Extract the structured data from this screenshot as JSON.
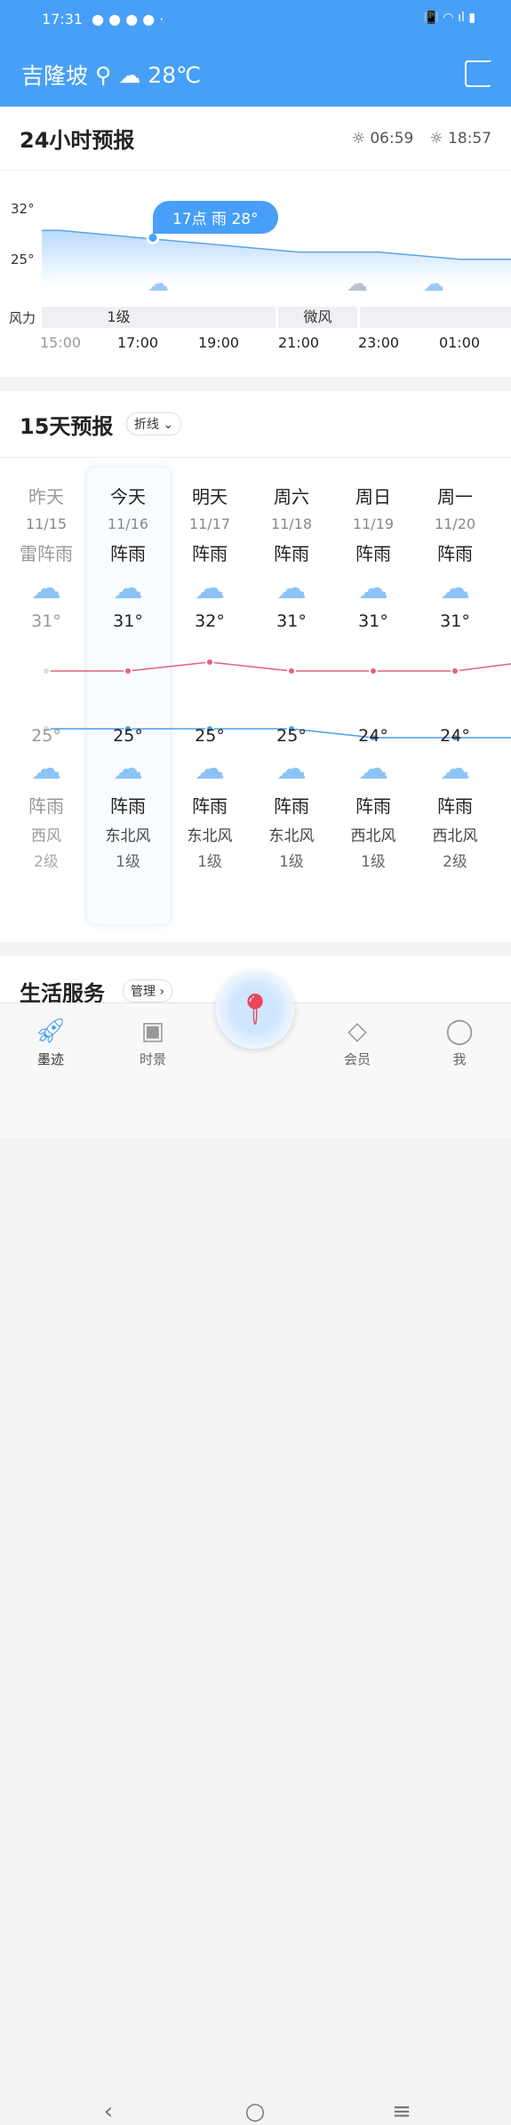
{
  "status": {
    "time": "17:31"
  },
  "header": {
    "city": "吉隆坡",
    "temp": "28℃",
    "weather_icon": "cloud-rain-icon"
  },
  "hourly": {
    "title": "24小时预报",
    "sunrise": "06:59",
    "sunset": "18:57",
    "y_ticks": [
      "32°",
      "25°"
    ],
    "tooltip": "17点 雨 28°",
    "wind_label": "风力",
    "wind": [
      {
        "label": "1级"
      },
      {
        "label": "微风"
      },
      {
        "label": ""
      }
    ],
    "hours": [
      "15:00",
      "17:00",
      "19:00",
      "21:00",
      "23:00",
      "01:00"
    ],
    "temps": [
      29,
      28,
      27,
      26,
      26,
      25
    ]
  },
  "daily": {
    "title": "15天预报",
    "mode": "折线",
    "days": [
      {
        "name": "昨天",
        "date": "11/15",
        "day_weather": "雷阵雨",
        "high": "31°",
        "low": "25°",
        "night_weather": "阵雨",
        "wind_dir": "西风",
        "wind_level": "2级"
      },
      {
        "name": "今天",
        "date": "11/16",
        "day_weather": "阵雨",
        "high": "31°",
        "low": "25°",
        "night_weather": "阵雨",
        "wind_dir": "东北风",
        "wind_level": "1级"
      },
      {
        "name": "明天",
        "date": "11/17",
        "day_weather": "阵雨",
        "high": "32°",
        "low": "25°",
        "night_weather": "阵雨",
        "wind_dir": "东北风",
        "wind_level": "1级"
      },
      {
        "name": "周六",
        "date": "11/18",
        "day_weather": "阵雨",
        "high": "31°",
        "low": "25°",
        "night_weather": "阵雨",
        "wind_dir": "东北风",
        "wind_level": "1级"
      },
      {
        "name": "周日",
        "date": "11/19",
        "day_weather": "阵雨",
        "high": "31°",
        "low": "24°",
        "night_weather": "阵雨",
        "wind_dir": "西北风",
        "wind_level": "1级"
      },
      {
        "name": "周一",
        "date": "11/20",
        "day_weather": "阵雨",
        "high": "31°",
        "low": "24°",
        "night_weather": "阵雨",
        "wind_dir": "西北风",
        "wind_level": "2级"
      }
    ],
    "highs": [
      31,
      31,
      32,
      31,
      31,
      31
    ],
    "lows": [
      25,
      25,
      25,
      25,
      24,
      24
    ],
    "colors": {
      "high": "#e8607a",
      "low": "#4a9de8"
    }
  },
  "services": {
    "title": "生活服务",
    "manage": "管理"
  },
  "nav": [
    {
      "label": "墨迹",
      "icon": "rocket-icon"
    },
    {
      "label": "时景",
      "icon": "image-icon"
    },
    {
      "label": "",
      "icon": "map-pin-icon"
    },
    {
      "label": "会员",
      "icon": "vip-icon"
    },
    {
      "label": "我",
      "icon": "user-icon"
    }
  ]
}
